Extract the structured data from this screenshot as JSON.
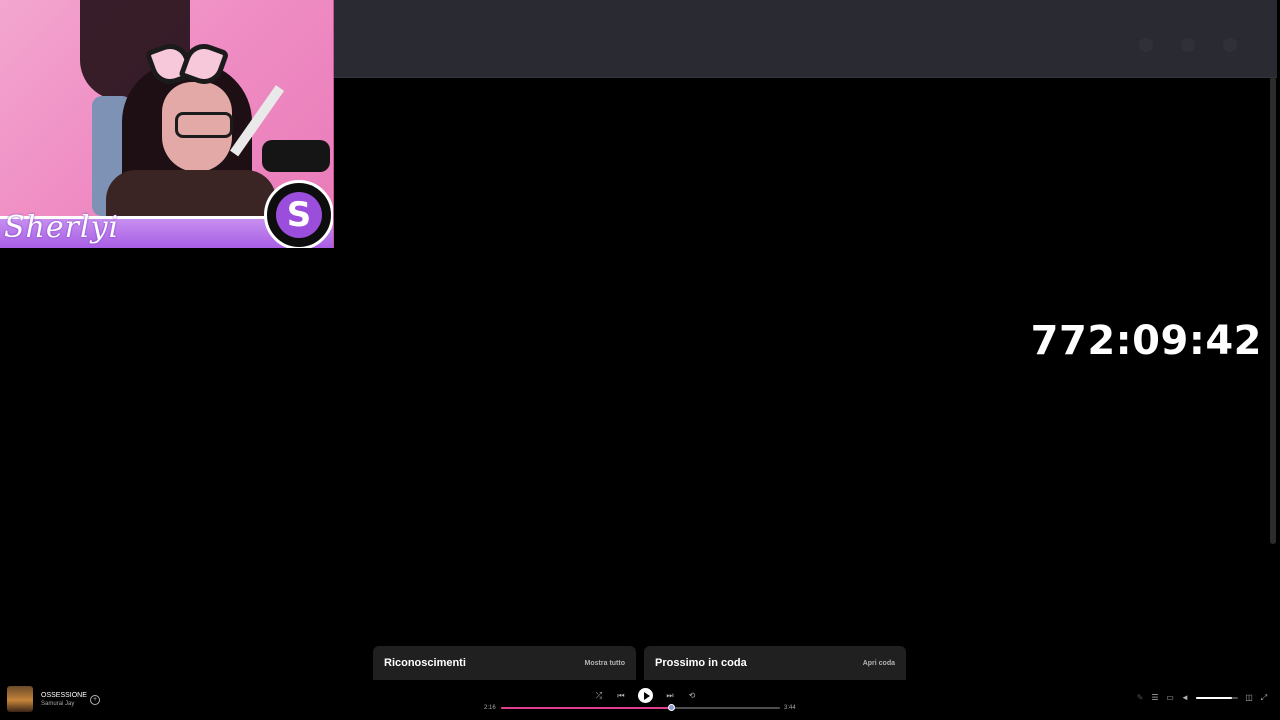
{
  "overlay": {
    "streamer_name": "Sherlyi",
    "logo_letter": "S",
    "colors": {
      "banner": "#a85ee5",
      "background": "#ef8dc4"
    }
  },
  "timer": {
    "value": "772:09:42"
  },
  "cards": {
    "credits": {
      "title": "Riconoscimenti",
      "link": "Mostra tutto"
    },
    "queue": {
      "title": "Prossimo in coda",
      "link": "Apri coda"
    }
  },
  "player": {
    "track_title": "OSSESSIONE",
    "track_artist": "Samurai Jay",
    "elapsed": "2:16",
    "total": "3:44",
    "progress_fraction": 0.61,
    "volume_fraction": 0.85,
    "icons": {
      "add": "add-circle-icon",
      "shuffle": "shuffle-icon",
      "previous": "previous-icon",
      "play": "play-icon",
      "next": "next-icon",
      "repeat": "repeat-icon",
      "lyrics": "microphone-icon",
      "queue": "queue-icon",
      "devices": "connect-device-icon",
      "volume": "volume-icon",
      "miniplayer": "miniplayer-icon",
      "fullscreen": "fullscreen-icon"
    },
    "colors": {
      "progress": "#e03e8c",
      "knob": "#8e9bd4"
    }
  }
}
